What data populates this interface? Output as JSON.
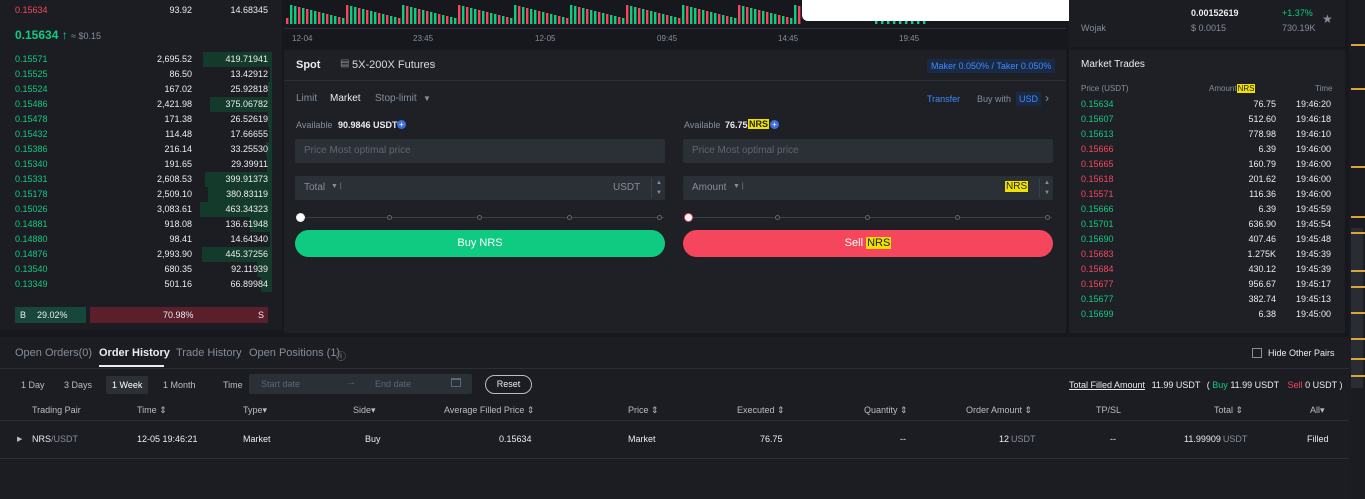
{
  "orderbook": {
    "top_row": {
      "price": "0.15634",
      "amount": "93.92",
      "total": "14.68345"
    },
    "last_price": "0.15634",
    "last_price_usd": "≈ $0.15",
    "bids": [
      {
        "price": "0.15571",
        "amount": "2,695.52",
        "total": "419.71941",
        "depth": 0.96
      },
      {
        "price": "0.15525",
        "amount": "86.50",
        "total": "13.42912",
        "depth": 0.03
      },
      {
        "price": "0.15524",
        "amount": "167.02",
        "total": "25.92818",
        "depth": 0.06
      },
      {
        "price": "0.15486",
        "amount": "2,421.98",
        "total": "375.06782",
        "depth": 0.86
      },
      {
        "price": "0.15478",
        "amount": "171.38",
        "total": "26.52619",
        "depth": 0.06
      },
      {
        "price": "0.15432",
        "amount": "114.48",
        "total": "17.66655",
        "depth": 0.04
      },
      {
        "price": "0.15386",
        "amount": "216.14",
        "total": "33.25530",
        "depth": 0.08
      },
      {
        "price": "0.15340",
        "amount": "191.65",
        "total": "29.39911",
        "depth": 0.07
      },
      {
        "price": "0.15331",
        "amount": "2,608.53",
        "total": "399.91373",
        "depth": 0.93
      },
      {
        "price": "0.15178",
        "amount": "2,509.10",
        "total": "380.83119",
        "depth": 0.89
      },
      {
        "price": "0.15026",
        "amount": "3,083.61",
        "total": "463.34323",
        "depth": 1.0
      },
      {
        "price": "0.14881",
        "amount": "918.08",
        "total": "136.61948",
        "depth": 0.31
      },
      {
        "price": "0.14880",
        "amount": "98.41",
        "total": "14.64340",
        "depth": 0.03
      },
      {
        "price": "0.14876",
        "amount": "2,993.90",
        "total": "445.37256",
        "depth": 0.97
      },
      {
        "price": "0.13540",
        "amount": "680.35",
        "total": "92.11939",
        "depth": 0.21
      },
      {
        "price": "0.13349",
        "amount": "501.16",
        "total": "66.89984",
        "depth": 0.15
      }
    ],
    "ratio": {
      "buy_label": "B",
      "buy_pct": "29.02%",
      "sell_pct": "70.98%",
      "sell_label": "S",
      "buy_fraction": 0.2902
    }
  },
  "chart": {
    "time_labels": [
      "12-04",
      "23:45",
      "12-05",
      "09:45",
      "14:45",
      "19:45"
    ]
  },
  "ticker_strip": {
    "name": "Wojak",
    "price": "0.00152619",
    "usd": "$ 0.0015",
    "change": "+1.37%",
    "volume": "730.19K"
  },
  "trade": {
    "tabs": [
      "Spot",
      "5X-200X Futures"
    ],
    "fee_badge": "Maker 0.050% / Taker 0.050%",
    "order_types": [
      "Limit",
      "Market",
      "Stop-limit"
    ],
    "transfer": "Transfer",
    "buy_with": "Buy with",
    "buy_with_currency": "USD",
    "buy": {
      "available_label": "Available",
      "available_value": "90.9846 USDT",
      "price_placeholder": "Price  Most optimal price",
      "total_label": "Total",
      "total_unit": "USDT",
      "button": "Buy NRS"
    },
    "sell": {
      "available_label": "Available",
      "available_value": "76.75",
      "available_unit": "NRS",
      "price_placeholder": "Price  Most optimal price",
      "amount_label": "Amount",
      "amount_unit": "NRS",
      "button_prefix": "Sell",
      "button_unit": "NRS"
    }
  },
  "market_trades": {
    "title": "Market Trades",
    "col_price": "Price (USDT)",
    "col_amount": "Amount",
    "col_amount_unit": "NRS",
    "col_time": "Time",
    "rows": [
      {
        "price": "0.15634",
        "amount": "76.75",
        "time": "19:46:20",
        "side": "buy"
      },
      {
        "price": "0.15607",
        "amount": "512.60",
        "time": "19:46:18",
        "side": "buy"
      },
      {
        "price": "0.15613",
        "amount": "778.98",
        "time": "19:46:10",
        "side": "buy"
      },
      {
        "price": "0.15666",
        "amount": "6.39",
        "time": "19:46:00",
        "side": "sell"
      },
      {
        "price": "0.15665",
        "amount": "160.79",
        "time": "19:46:00",
        "side": "sell"
      },
      {
        "price": "0.15618",
        "amount": "201.62",
        "time": "19:46:00",
        "side": "sell"
      },
      {
        "price": "0.15571",
        "amount": "116.36",
        "time": "19:46:00",
        "side": "sell"
      },
      {
        "price": "0.15666",
        "amount": "6.39",
        "time": "19:45:59",
        "side": "buy"
      },
      {
        "price": "0.15701",
        "amount": "636.90",
        "time": "19:45:54",
        "side": "buy"
      },
      {
        "price": "0.15690",
        "amount": "407.46",
        "time": "19:45:48",
        "side": "buy"
      },
      {
        "price": "0.15683",
        "amount": "1.275K",
        "time": "19:45:39",
        "side": "sell"
      },
      {
        "price": "0.15684",
        "amount": "430.12",
        "time": "19:45:39",
        "side": "sell"
      },
      {
        "price": "0.15677",
        "amount": "956.67",
        "time": "19:45:17",
        "side": "sell"
      },
      {
        "price": "0.15677",
        "amount": "382.74",
        "time": "19:45:13",
        "side": "buy"
      },
      {
        "price": "0.15699",
        "amount": "6.38",
        "time": "19:45:00",
        "side": "buy"
      }
    ]
  },
  "orders": {
    "tabs": [
      "Open Orders(0)",
      "Order History",
      "Trade History",
      "Open Positions (1)"
    ],
    "hide_other_pairs": "Hide Other Pairs",
    "ranges": [
      "1 Day",
      "3 Days",
      "1 Week",
      "1 Month"
    ],
    "time_label": "Time",
    "start_date": "Start date",
    "end_date": "End date",
    "reset": "Reset",
    "summary": {
      "label": "Total Filled Amount",
      "value": "11.99 USDT",
      "buy_label": "Buy",
      "buy_value": "11.99 USDT",
      "sell_label": "Sell",
      "sell_value": "0 USDT"
    },
    "columns": [
      "Trading Pair",
      "Time",
      "Type",
      "Side",
      "Average Filled Price",
      "Price",
      "Executed",
      "Quantity",
      "Order Amount",
      "TP/SL",
      "Total",
      "All"
    ],
    "row": {
      "pair_base": "NRS",
      "pair_quote": "/USDT",
      "time": "12-05 19:46:21",
      "type": "Market",
      "side": "Buy",
      "avg_price": "0.15634",
      "price": "Market",
      "executed": "76.75",
      "quantity": "--",
      "order_amount": "12",
      "order_amount_unit": "USDT",
      "tpsl": "--",
      "total": "11.99909",
      "total_unit": "USDT",
      "status": "Filled"
    }
  },
  "colors": {
    "buy": "#0ecb81",
    "sell": "#f6465d",
    "highlight": "#f0e100",
    "accent": "#1f6feb"
  }
}
